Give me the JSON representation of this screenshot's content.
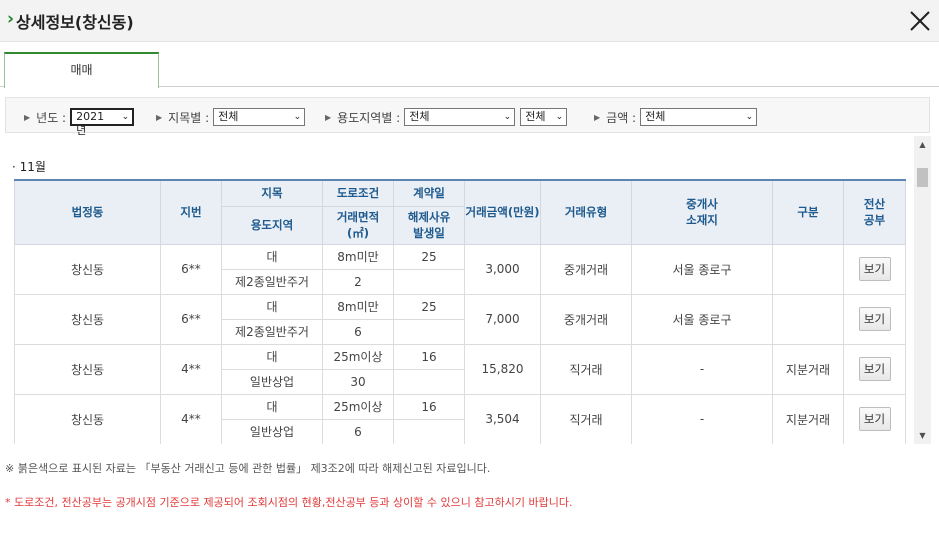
{
  "header": {
    "title": "상세정보(창신동)"
  },
  "tabs": [
    {
      "label": "매매"
    }
  ],
  "filters": {
    "year": {
      "label": "년도 :",
      "value": "2021년"
    },
    "land": {
      "label": "지목별 :",
      "value": "전체"
    },
    "zone": {
      "label": "용도지역별 :",
      "value": "전체",
      "value2": "전체"
    },
    "amount": {
      "label": "금액 :",
      "value": "전체"
    }
  },
  "month_label": "· 11월",
  "table": {
    "headers": {
      "dong": "법정동",
      "jibun": "지번",
      "jimok": "지목",
      "road": "도로조건",
      "contract_day": "계약일",
      "price": "거래금액(만원)",
      "deal_type": "거래유형",
      "agent_line1": "중개사",
      "agent_line2": "소재지",
      "category": "구분",
      "doc_line1": "전산",
      "doc_line2": "공부",
      "zone": "용도지역",
      "area_line1": "거래면적",
      "area_line2": "(㎡)",
      "cancel_line1": "해제사유",
      "cancel_line2": "발생일"
    },
    "rows": [
      {
        "dong": "창신동",
        "jibun": "6**",
        "jimok": "대",
        "road": "8m미만",
        "day": "25",
        "price": "3,000",
        "deal_type": "중개거래",
        "agent": "서울 종로구",
        "category": "",
        "zone": "제2종일반주거",
        "area": "2",
        "cancel": "",
        "button": "보기"
      },
      {
        "dong": "창신동",
        "jibun": "6**",
        "jimok": "대",
        "road": "8m미만",
        "day": "25",
        "price": "7,000",
        "deal_type": "중개거래",
        "agent": "서울 종로구",
        "category": "",
        "zone": "제2종일반주거",
        "area": "6",
        "cancel": "",
        "button": "보기"
      },
      {
        "dong": "창신동",
        "jibun": "4**",
        "jimok": "대",
        "road": "25m이상",
        "day": "16",
        "price": "15,820",
        "deal_type": "직거래",
        "agent": "-",
        "category": "지분거래",
        "zone": "일반상업",
        "area": "30",
        "cancel": "",
        "button": "보기"
      },
      {
        "dong": "창신동",
        "jibun": "4**",
        "jimok": "대",
        "road": "25m이상",
        "day": "16",
        "price": "3,504",
        "deal_type": "직거래",
        "agent": "-",
        "category": "지분거래",
        "zone": "일반상업",
        "area": "6",
        "cancel": "",
        "button": "보기"
      }
    ]
  },
  "notes": {
    "note1": "※ 붉은색으로 표시된 자료는 「부동산 거래신고 등에 관한 법률」 제3조2에 따라 해제신고된 자료입니다.",
    "note2": "* 도로조건, 전산공부는 공개시점 기준으로 제공되어 조회시점의 현황,전산공부 등과 상이할 수 있으니 참고하시기 바랍니다."
  },
  "colors": {
    "accent": "#2e8b2e",
    "header_text": "#1e5a8e",
    "warning": "#e03a3a"
  }
}
